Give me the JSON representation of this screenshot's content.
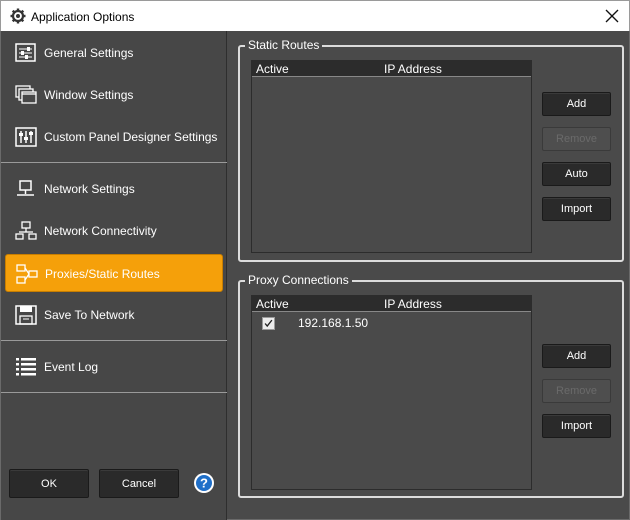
{
  "window": {
    "title": "Application Options"
  },
  "sidebar": {
    "items": [
      {
        "label": "General Settings",
        "icon": "general-settings-icon"
      },
      {
        "label": "Window Settings",
        "icon": "window-settings-icon"
      },
      {
        "label": "Custom Panel Designer Settings",
        "icon": "panel-designer-icon"
      },
      {
        "label": "Network Settings",
        "icon": "network-settings-icon"
      },
      {
        "label": "Network Connectivity",
        "icon": "network-connectivity-icon"
      },
      {
        "label": "Proxies/Static Routes",
        "icon": "proxies-icon",
        "active": true
      },
      {
        "label": "Save To Network",
        "icon": "save-to-network-icon"
      },
      {
        "label": "Event Log",
        "icon": "event-log-icon"
      }
    ],
    "ok_label": "OK",
    "cancel_label": "Cancel"
  },
  "static_routes": {
    "title": "Static Routes",
    "columns": {
      "active": "Active",
      "ip": "IP Address"
    },
    "rows": [],
    "buttons": {
      "add": "Add",
      "remove": "Remove",
      "auto": "Auto",
      "import": "Import"
    }
  },
  "proxy_connections": {
    "title": "Proxy Connections",
    "columns": {
      "active": "Active",
      "ip": "IP Address"
    },
    "rows": [
      {
        "active": true,
        "ip": "192.168.1.50"
      }
    ],
    "buttons": {
      "add": "Add",
      "remove": "Remove",
      "import": "Import"
    }
  },
  "colors": {
    "accent": "#f5a00a",
    "background": "#4a4a4a",
    "button": "#2a2a2a"
  }
}
